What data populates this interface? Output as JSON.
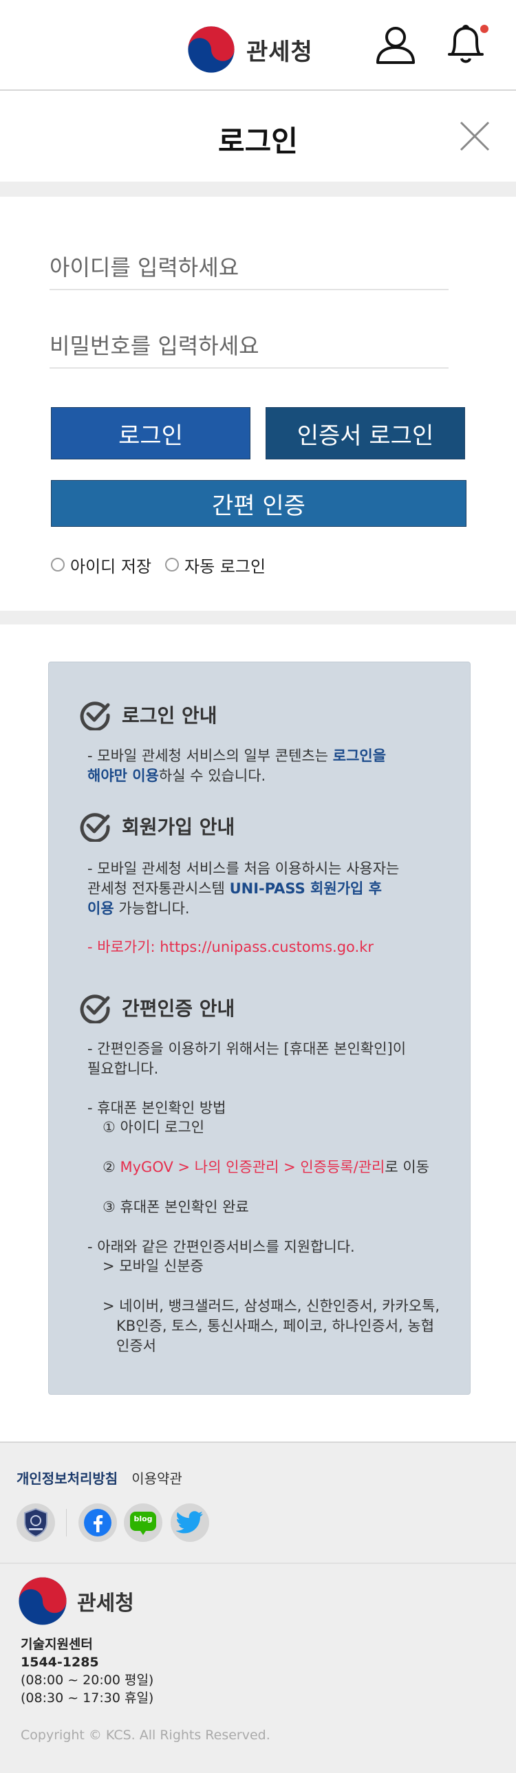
{
  "header": {
    "logo_text": "관세청",
    "user_icon": "user-icon",
    "bell_icon": "bell-icon",
    "notification_dot_color": "#e0453b"
  },
  "page": {
    "title": "로그인",
    "close_icon": "close-icon"
  },
  "login_form": {
    "id_placeholder": "아이디를 입력하세요",
    "id_value": "",
    "pw_placeholder": "비밀번호를 입력하세요",
    "pw_value": "",
    "login_button": "로그인",
    "cert_login_button": "인증서 로그인",
    "simple_auth_button": "간편 인증",
    "save_id_label": "아이디 저장",
    "auto_login_label": "자동 로그인"
  },
  "info": {
    "login_guide": {
      "title": "로그인 안내",
      "line1_a": "- 모바일 관세청 서비스의 일부 콘텐츠는 ",
      "line1_b": "로그인을",
      "line2_a": "해야만 이용",
      "line2_b": "하실 수 있습니다."
    },
    "join_guide": {
      "title": "회원가입 안내",
      "line1": "- 모바일 관세청 서비스를 처음 이용하시는 사용자는",
      "line2_a": "관세청 전자통관시스템 ",
      "line2_b": "UNI-PASS 회원가입 후",
      "line3_a": "이용",
      "line3_b": " 가능합니다.",
      "shortcut": "- 바로가기: https://unipass.customs.go.kr"
    },
    "simple_guide": {
      "title": "간편인증 안내",
      "p1_line1": "- 간편인증을 이용하기 위해서는 [휴대폰 본인확인]이",
      "p1_line2": "필요합니다.",
      "method_title": "- 휴대폰 본인확인 방법",
      "step1": "① 아이디 로그인",
      "step2_prefix": "② ",
      "step2_red": "MyGOV > 나의 인증관리 > 인증등록/관리",
      "step2_suffix": "로 이동",
      "step3": "③ 휴대폰 본인확인 완료",
      "supported_title": "- 아래와 같은 간편인증서비스를 지원합니다.",
      "supported_1": "> 모바일 신분증",
      "supported_2_line1": "> 네이버, 뱅크샐러드, 삼성패스, 신한인증서, 카카오톡,",
      "supported_2_line2": "KB인증, 토스, 통신사패스, 페이코, 하나인증서, 농협",
      "supported_2_line3": "인증서"
    }
  },
  "footer": {
    "privacy_link": "개인정보처리방침",
    "terms_link": "이용약관",
    "social_icons": [
      "emblem-icon",
      "facebook-icon",
      "blog-icon",
      "twitter-icon"
    ],
    "blog_label": "blog",
    "logo_text": "관세청",
    "center_title": "기술지원센터",
    "center_phone": "1544-1285",
    "center_hours_weekday": "(08:00 ~ 20:00 평일)",
    "center_hours_holiday": "(08:30 ~ 17:30 휴일)",
    "copyright": "Copyright © KCS. All Rights Reserved."
  },
  "colors": {
    "login_button": "#1f5aa6",
    "cert_button": "#184e7b",
    "simple_button": "#216aa3",
    "info_panel_bg": "#d1d9e1",
    "highlight_blue": "#1b4a8a",
    "highlight_red": "#e62e4d"
  }
}
